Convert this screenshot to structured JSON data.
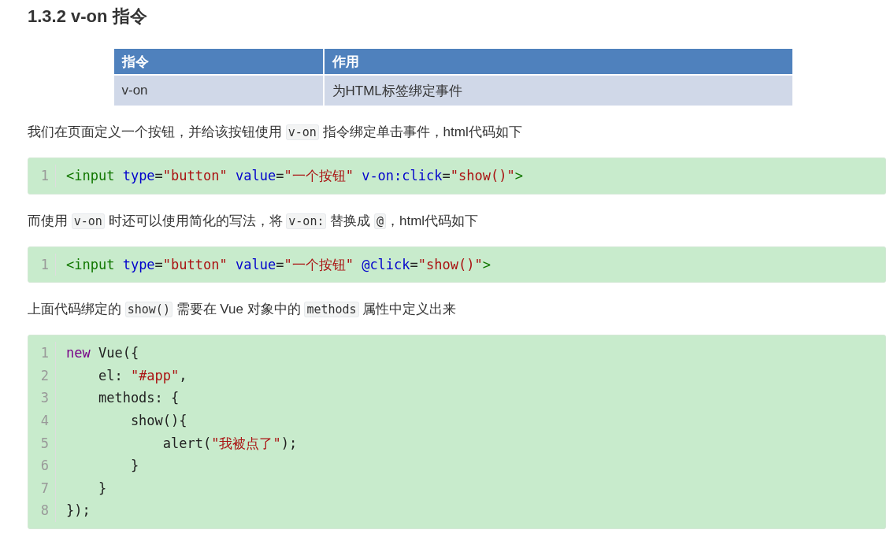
{
  "heading": "1.3.2 v-on 指令",
  "table": {
    "columns": [
      "指令",
      "作用"
    ],
    "rows": [
      [
        "v-on",
        "为HTML标签绑定事件"
      ]
    ]
  },
  "blocks": [
    {
      "kind": "paragraph",
      "segments": [
        {
          "kind": "text",
          "text": "我们在页面定义一个按钮，并给该按钮使用 "
        },
        {
          "kind": "code",
          "text": "v-on"
        },
        {
          "kind": "text",
          "text": " 指令绑定单击事件，html代码如下"
        }
      ]
    },
    {
      "kind": "code",
      "lines": [
        {
          "number": "1",
          "tokens": [
            {
              "kind": "tag",
              "text": "<input"
            },
            {
              "kind": "attr",
              "text": " type"
            },
            {
              "kind": "plain",
              "text": "="
            },
            {
              "kind": "str",
              "text": "\"button\""
            },
            {
              "kind": "attr",
              "text": " value"
            },
            {
              "kind": "plain",
              "text": "="
            },
            {
              "kind": "str",
              "text": "\"一个按钮\""
            },
            {
              "kind": "attr",
              "text": " v-on:click"
            },
            {
              "kind": "plain",
              "text": "="
            },
            {
              "kind": "str",
              "text": "\"show()\""
            },
            {
              "kind": "tag",
              "text": ">"
            }
          ]
        }
      ]
    },
    {
      "kind": "paragraph",
      "segments": [
        {
          "kind": "text",
          "text": "而使用 "
        },
        {
          "kind": "code",
          "text": "v-on"
        },
        {
          "kind": "text",
          "text": " 时还可以使用简化的写法，将 "
        },
        {
          "kind": "code",
          "text": "v-on:"
        },
        {
          "kind": "text",
          "text": " 替换成 "
        },
        {
          "kind": "code",
          "text": "@"
        },
        {
          "kind": "text",
          "text": "，html代码如下"
        }
      ]
    },
    {
      "kind": "code",
      "lines": [
        {
          "number": "1",
          "tokens": [
            {
              "kind": "tag",
              "text": "<input"
            },
            {
              "kind": "attr",
              "text": " type"
            },
            {
              "kind": "plain",
              "text": "="
            },
            {
              "kind": "str",
              "text": "\"button\""
            },
            {
              "kind": "attr",
              "text": " value"
            },
            {
              "kind": "plain",
              "text": "="
            },
            {
              "kind": "str",
              "text": "\"一个按钮\""
            },
            {
              "kind": "attr",
              "text": " @click"
            },
            {
              "kind": "plain",
              "text": "="
            },
            {
              "kind": "str",
              "text": "\"show()\""
            },
            {
              "kind": "tag",
              "text": ">"
            }
          ]
        }
      ]
    },
    {
      "kind": "paragraph",
      "segments": [
        {
          "kind": "text",
          "text": "上面代码绑定的 "
        },
        {
          "kind": "code",
          "text": "show()"
        },
        {
          "kind": "text",
          "text": " 需要在 Vue 对象中的 "
        },
        {
          "kind": "code",
          "text": "methods"
        },
        {
          "kind": "text",
          "text": " 属性中定义出来"
        }
      ]
    },
    {
      "kind": "code",
      "lines": [
        {
          "number": "1",
          "tokens": [
            {
              "kind": "kw",
              "text": "new"
            },
            {
              "kind": "plain",
              "text": " Vue({"
            }
          ]
        },
        {
          "number": "2",
          "tokens": [
            {
              "kind": "plain",
              "text": "    el: "
            },
            {
              "kind": "str",
              "text": "\"#app\""
            },
            {
              "kind": "plain",
              "text": ","
            }
          ]
        },
        {
          "number": "3",
          "tokens": [
            {
              "kind": "plain",
              "text": "    methods: {"
            }
          ]
        },
        {
          "number": "4",
          "tokens": [
            {
              "kind": "plain",
              "text": "        show(){"
            }
          ]
        },
        {
          "number": "5",
          "tokens": [
            {
              "kind": "plain",
              "text": "            alert("
            },
            {
              "kind": "str",
              "text": "\"我被点了\""
            },
            {
              "kind": "plain",
              "text": ");"
            }
          ]
        },
        {
          "number": "6",
          "tokens": [
            {
              "kind": "plain",
              "text": "        }"
            }
          ]
        },
        {
          "number": "7",
          "tokens": [
            {
              "kind": "plain",
              "text": "    }"
            }
          ]
        },
        {
          "number": "8",
          "tokens": [
            {
              "kind": "plain",
              "text": "});"
            }
          ]
        }
      ]
    }
  ]
}
